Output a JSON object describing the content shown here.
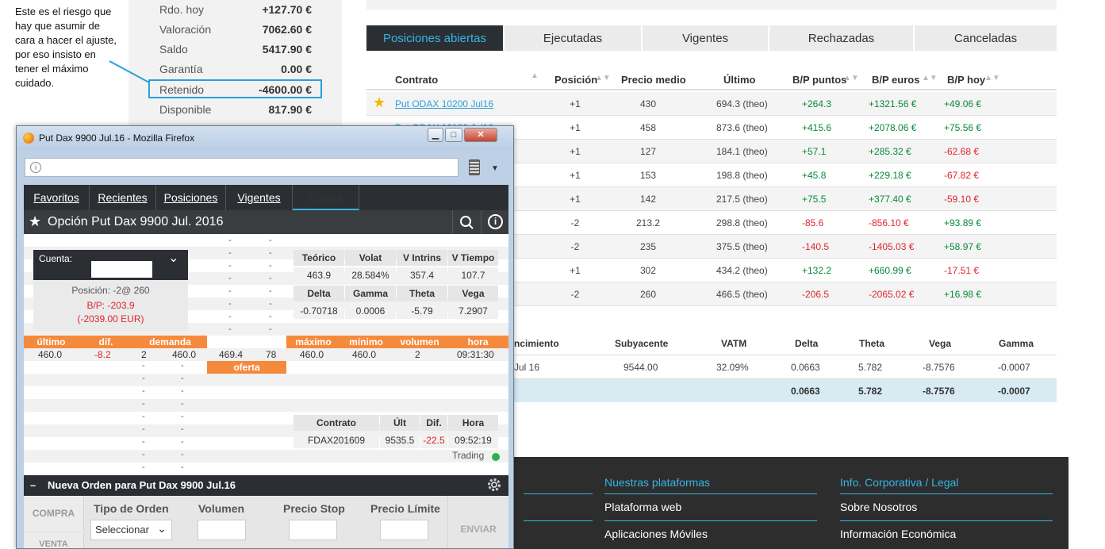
{
  "annotation": {
    "lines": [
      "Este es el riesgo que",
      "hay que asumir de",
      "cara a hacer el ajuste,",
      "por eso insisto en",
      "tener el máximo",
      "cuidado."
    ]
  },
  "summary": {
    "rows": [
      {
        "label": "Rdo. hoy",
        "value": "+127.70 €"
      },
      {
        "label": "Valoración",
        "value": "7062.60 €"
      },
      {
        "label": "Saldo",
        "value": "5417.90 €"
      },
      {
        "label": "Garantía",
        "value": "0.00 €"
      },
      {
        "label": "Retenido",
        "value": "-4600.00 €"
      },
      {
        "label": "Disponible",
        "value": "817.90 €"
      }
    ]
  },
  "tabs": [
    "Posiciones abiertas",
    "Ejecutadas",
    "Vigentes",
    "Rechazadas",
    "Canceladas"
  ],
  "positions": {
    "headers": [
      "Contrato",
      "Posición",
      "Precio medio",
      "Último",
      "B/P puntos",
      "B/P euros",
      "B/P hoy"
    ],
    "rows": [
      {
        "contract": "Put ODAX 10200 Jul16",
        "pos": "+1",
        "avg": "430",
        "last": "694.3 (theo)",
        "pts": "+264.3",
        "eur": "+1321.56 €",
        "today": "+49.06 €"
      },
      {
        "contract": "Put ODAX 10100 Jul16",
        "pos": "+1",
        "avg": "458",
        "last": "873.6 (theo)",
        "pts": "+415.6",
        "eur": "+2078.06 €",
        "today": "+75.56 €"
      },
      {
        "contract": "",
        "pos": "+1",
        "avg": "127",
        "last": "184.1 (theo)",
        "pts": "+57.1",
        "eur": "+285.32 €",
        "today": "-62.68 €"
      },
      {
        "contract": "",
        "pos": "+1",
        "avg": "153",
        "last": "198.8 (theo)",
        "pts": "+45.8",
        "eur": "+229.18 €",
        "today": "-67.82 €"
      },
      {
        "contract": "",
        "pos": "+1",
        "avg": "142",
        "last": "217.5 (theo)",
        "pts": "+75.5",
        "eur": "+377.40 €",
        "today": "-59.10 €"
      },
      {
        "contract": "",
        "pos": "-2",
        "avg": "213.2",
        "last": "298.8 (theo)",
        "pts": "-85.6",
        "eur": "-856.10 €",
        "today": "+93.89 €"
      },
      {
        "contract": "",
        "pos": "-2",
        "avg": "235",
        "last": "375.5 (theo)",
        "pts": "-140.5",
        "eur": "-1405.03 €",
        "today": "+58.97 €"
      },
      {
        "contract": "",
        "pos": "+1",
        "avg": "302",
        "last": "434.2 (theo)",
        "pts": "+132.2",
        "eur": "+660.99 €",
        "today": "-17.51 €"
      },
      {
        "contract": "",
        "pos": "-2",
        "avg": "260",
        "last": "466.5 (theo)",
        "pts": "-206.5",
        "eur": "-2065.02 €",
        "today": "+16.98 €"
      }
    ]
  },
  "greeks_table": {
    "headers": [
      "ncimiento",
      "Subyacente",
      "VATM",
      "Delta",
      "Theta",
      "Vega",
      "Gamma"
    ],
    "row": [
      "Jul 16",
      "9544.00",
      "32.09%",
      "0.0663",
      "5.782",
      "-8.7576",
      "-0.0007"
    ],
    "total": [
      "",
      "",
      "",
      "0.0663",
      "5.782",
      "-8.7576",
      "-0.0007"
    ]
  },
  "footer": {
    "col2": {
      "title": "Nuestras plataformas",
      "links": [
        "Plataforma web",
        "Aplicaciones Móviles"
      ]
    },
    "col3": {
      "title": "Info. Corporativa / Legal",
      "links": [
        "Sobre Nosotros",
        "Información Económica"
      ]
    }
  },
  "firefox": {
    "title": "Put Dax 9900 Jul.16 - Mozilla Firefox",
    "buttons": {
      "min": "▁",
      "max": "□",
      "close": "✕"
    }
  },
  "app": {
    "nav": [
      "Favoritos",
      "Recientes",
      "Posiciones",
      "Vigentes",
      "Cuenta"
    ],
    "option_title": "Opción Put Dax 9900 Jul. 2016",
    "cuenta_label": "Cuenta:",
    "position": "Posición: -2@ 260",
    "bp": "B/P: -203.9",
    "bp_eur": "(-2039.00 EUR)",
    "greeks": {
      "h1": [
        "Teórico",
        "Volat",
        "V Intrins",
        "V Tiempo"
      ],
      "v1": [
        "463.9",
        "28.584%",
        "357.4",
        "107.7"
      ],
      "h2": [
        "Delta",
        "Gamma",
        "Theta",
        "Vega"
      ],
      "v2": [
        "-0.70718",
        "0.0006",
        "-5.79",
        "7.2907"
      ]
    },
    "quote_headers": {
      "ultimo": "último",
      "dif": "dif.",
      "demanda": "demanda",
      "oferta": "oferta",
      "maximo": "máximo",
      "minimo": "mínimo",
      "volumen": "volumen",
      "hora": "hora"
    },
    "quote": {
      "ultimo": "460.0",
      "dif": "-8.2",
      "bid_qty": "2",
      "bid": "460.0",
      "ask": "469.4",
      "ask_qty": "78",
      "maximo": "460.0",
      "minimo": "460.0",
      "volumen": "2",
      "hora": "09:31:30"
    },
    "dash": "-",
    "underlying": {
      "headers": [
        "Contrato",
        "Últ",
        "Dif.",
        "Hora"
      ],
      "values": [
        "FDAX201609",
        "9535.5",
        "-22.5",
        "09:52:19"
      ]
    },
    "trading": "Trading",
    "order": {
      "minus": "–",
      "title": "Nueva Orden para Put Dax 9900 Jul.16",
      "compra": "COMPRA",
      "venta": "VENTA",
      "tipo": "Tipo de Orden",
      "select": "Seleccionar",
      "volumen": "Volumen",
      "stop": "Precio Stop",
      "limite": "Precio Límite",
      "enviar": "ENVIAR"
    }
  }
}
